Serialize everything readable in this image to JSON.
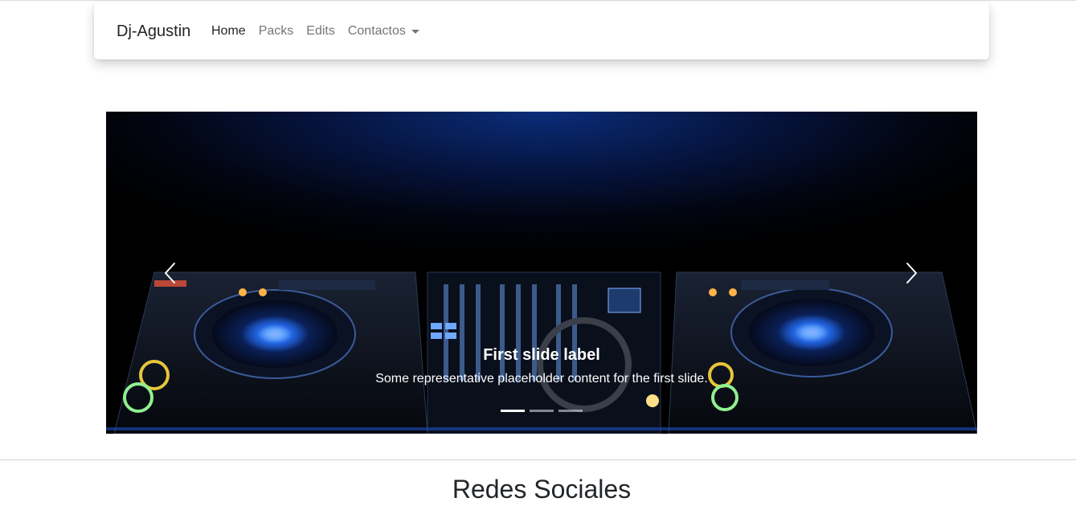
{
  "navbar": {
    "brand": "Dj-Agustin",
    "links": [
      {
        "label": "Home",
        "active": true
      },
      {
        "label": "Packs",
        "active": false
      },
      {
        "label": "Edits",
        "active": false
      }
    ],
    "dropdown": {
      "label": "Contactos",
      "icon": "caret-down-icon"
    }
  },
  "carousel": {
    "slide": {
      "caption_title": "First slide label",
      "caption_text": "Some representative placeholder content for the first slide."
    },
    "indicators": [
      true,
      false,
      false
    ],
    "prev_icon": "chevron-left-icon",
    "next_icon": "chevron-right-icon"
  },
  "section": {
    "title": "Redes Sociales"
  },
  "colors": {
    "text_dark": "#212529",
    "text_muted": "#767676",
    "accent_blue": "#2a6cff"
  }
}
